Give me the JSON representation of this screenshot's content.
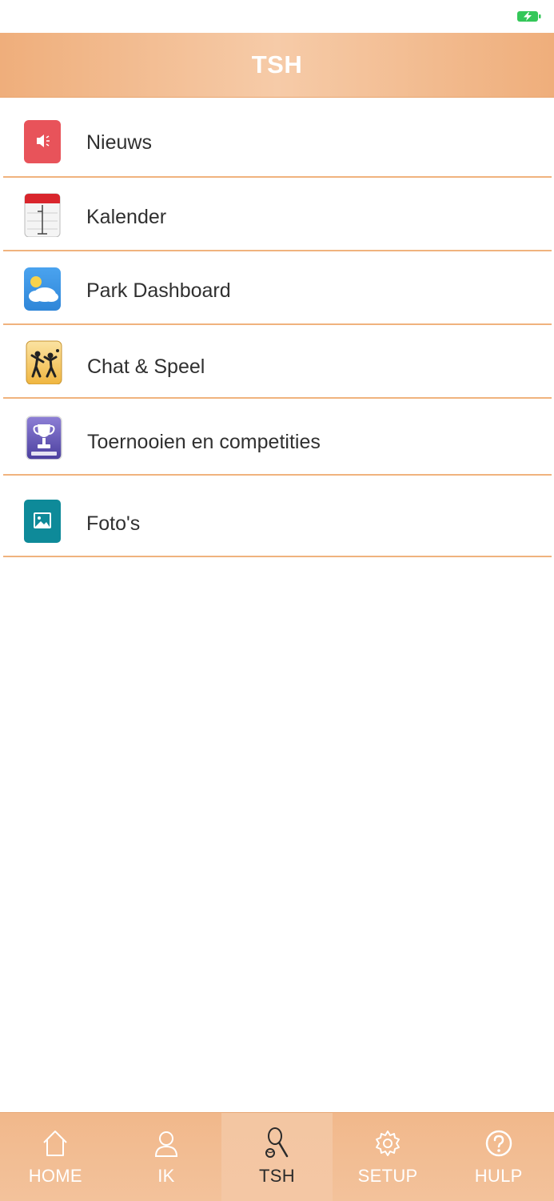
{
  "header": {
    "title": "TSH"
  },
  "menu": {
    "items": [
      {
        "label": "Nieuws",
        "icon": "megaphone-icon"
      },
      {
        "label": "Kalender",
        "icon": "calendar-icon"
      },
      {
        "label": "Park Dashboard",
        "icon": "weather-cloud-icon"
      },
      {
        "label": "Chat & Speel",
        "icon": "tennis-players-icon"
      },
      {
        "label": "Toernooien en competities",
        "icon": "trophy-icon"
      },
      {
        "label": "Foto's",
        "icon": "photo-icon"
      }
    ]
  },
  "tabbar": {
    "tabs": [
      {
        "label": "HOME",
        "icon": "home-icon",
        "active": false
      },
      {
        "label": "IK",
        "icon": "person-icon",
        "active": false
      },
      {
        "label": "TSH",
        "icon": "tennis-racket-icon",
        "active": true
      },
      {
        "label": "SETUP",
        "icon": "gear-icon",
        "active": false
      },
      {
        "label": "HULP",
        "icon": "help-icon",
        "active": false
      }
    ]
  },
  "colors": {
    "accent": "#efae7b",
    "divider": "#f0b37e",
    "battery": "#34c759"
  }
}
